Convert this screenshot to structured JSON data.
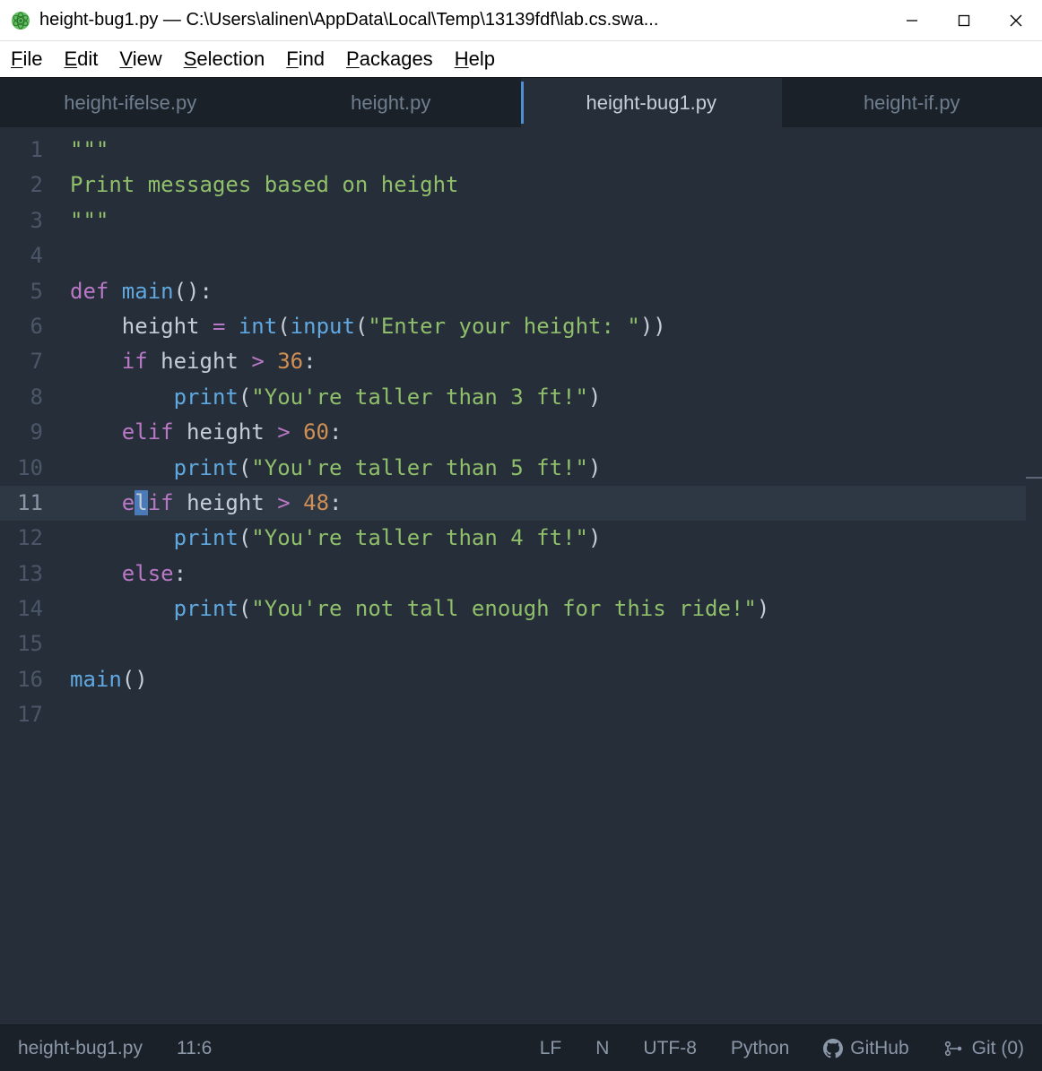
{
  "window": {
    "title": "height-bug1.py — C:\\Users\\alinen\\AppData\\Local\\Temp\\13139fdf\\lab.cs.swa..."
  },
  "menu": {
    "file": "File",
    "edit": "Edit",
    "view": "View",
    "selection": "Selection",
    "find": "Find",
    "packages": "Packages",
    "help": "Help"
  },
  "tabs": [
    {
      "label": "height-ifelse.py",
      "active": false
    },
    {
      "label": "height.py",
      "active": false
    },
    {
      "label": "height-bug1.py",
      "active": true
    },
    {
      "label": "height-if.py",
      "active": false
    }
  ],
  "code": {
    "lines": [
      {
        "n": 1,
        "tokens": [
          {
            "t": "\"\"\"",
            "c": "str"
          }
        ]
      },
      {
        "n": 2,
        "tokens": [
          {
            "t": "Print messages based on height",
            "c": "str"
          }
        ]
      },
      {
        "n": 3,
        "tokens": [
          {
            "t": "\"\"\"",
            "c": "str"
          }
        ]
      },
      {
        "n": 4,
        "tokens": []
      },
      {
        "n": 5,
        "tokens": [
          {
            "t": "def ",
            "c": "def"
          },
          {
            "t": "main",
            "c": "fn"
          },
          {
            "t": "()",
            "c": "punc"
          },
          {
            "t": ":",
            "c": "punc"
          }
        ]
      },
      {
        "n": 6,
        "indent": 1,
        "tokens": [
          {
            "t": "height ",
            "c": "name"
          },
          {
            "t": "= ",
            "c": "op"
          },
          {
            "t": "int",
            "c": "builtin"
          },
          {
            "t": "(",
            "c": "punc"
          },
          {
            "t": "input",
            "c": "builtin"
          },
          {
            "t": "(",
            "c": "punc"
          },
          {
            "t": "\"Enter your height: \"",
            "c": "str"
          },
          {
            "t": "))",
            "c": "punc"
          }
        ]
      },
      {
        "n": 7,
        "indent": 1,
        "tokens": [
          {
            "t": "if ",
            "c": "kw"
          },
          {
            "t": "height ",
            "c": "name"
          },
          {
            "t": "> ",
            "c": "op"
          },
          {
            "t": "36",
            "c": "num"
          },
          {
            "t": ":",
            "c": "punc"
          }
        ]
      },
      {
        "n": 8,
        "indent": 2,
        "tokens": [
          {
            "t": "print",
            "c": "builtin"
          },
          {
            "t": "(",
            "c": "punc"
          },
          {
            "t": "\"You're taller than 3 ft!\"",
            "c": "str"
          },
          {
            "t": ")",
            "c": "punc"
          }
        ]
      },
      {
        "n": 9,
        "indent": 1,
        "tokens": [
          {
            "t": "elif ",
            "c": "kw"
          },
          {
            "t": "height ",
            "c": "name"
          },
          {
            "t": "> ",
            "c": "op"
          },
          {
            "t": "60",
            "c": "num"
          },
          {
            "t": ":",
            "c": "punc"
          }
        ]
      },
      {
        "n": 10,
        "indent": 2,
        "tokens": [
          {
            "t": "print",
            "c": "builtin"
          },
          {
            "t": "(",
            "c": "punc"
          },
          {
            "t": "\"You're taller than 5 ft!\"",
            "c": "str"
          },
          {
            "t": ")",
            "c": "punc"
          }
        ]
      },
      {
        "n": 11,
        "indent": 1,
        "active": true,
        "tokens": [
          {
            "t": "e",
            "c": "kw"
          },
          {
            "t": "l",
            "c": "kw",
            "sel": true
          },
          {
            "t": "if ",
            "c": "kw"
          },
          {
            "t": "height ",
            "c": "name"
          },
          {
            "t": "> ",
            "c": "op"
          },
          {
            "t": "48",
            "c": "num"
          },
          {
            "t": ":",
            "c": "punc"
          }
        ]
      },
      {
        "n": 12,
        "indent": 2,
        "tokens": [
          {
            "t": "print",
            "c": "builtin"
          },
          {
            "t": "(",
            "c": "punc"
          },
          {
            "t": "\"You're taller than 4 ft!\"",
            "c": "str"
          },
          {
            "t": ")",
            "c": "punc"
          }
        ]
      },
      {
        "n": 13,
        "indent": 1,
        "tokens": [
          {
            "t": "else",
            "c": "kw"
          },
          {
            "t": ":",
            "c": "punc"
          }
        ]
      },
      {
        "n": 14,
        "indent": 2,
        "tokens": [
          {
            "t": "print",
            "c": "builtin"
          },
          {
            "t": "(",
            "c": "punc"
          },
          {
            "t": "\"You're not tall enough for this ride!\"",
            "c": "str"
          },
          {
            "t": ")",
            "c": "punc"
          }
        ]
      },
      {
        "n": 15,
        "tokens": []
      },
      {
        "n": 16,
        "tokens": [
          {
            "t": "main",
            "c": "fn"
          },
          {
            "t": "()",
            "c": "punc"
          }
        ]
      },
      {
        "n": 17,
        "tokens": []
      }
    ]
  },
  "status": {
    "filename": "height-bug1.py",
    "cursor": "11:6",
    "line_ending": "LF",
    "n": "N",
    "encoding": "UTF-8",
    "language": "Python",
    "github": "GitHub",
    "git": "Git (0)"
  }
}
